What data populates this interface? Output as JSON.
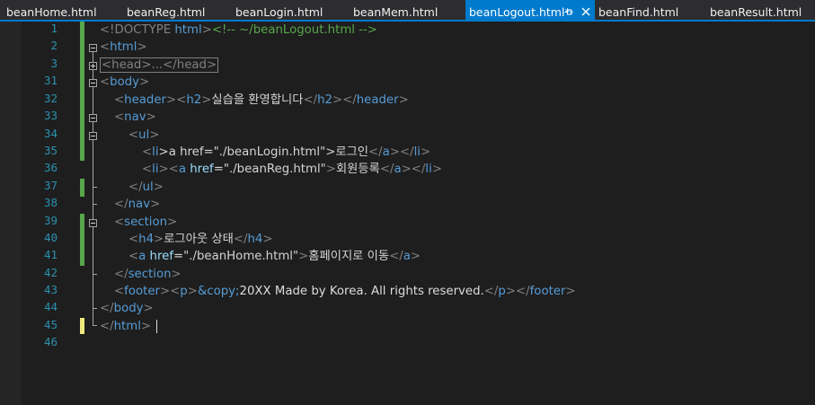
{
  "tabs": [
    {
      "label": "beanHome.html",
      "active": false
    },
    {
      "label": "beanReg.html",
      "active": false
    },
    {
      "label": "beanLogin.html",
      "active": false
    },
    {
      "label": "beanMem.html",
      "active": false
    },
    {
      "label": "beanLogout.html*",
      "active": true
    },
    {
      "label": "beanFind.html",
      "active": false
    },
    {
      "label": "beanResult.html",
      "active": false
    }
  ],
  "active_tab_icons": {
    "pin": "pin-icon",
    "close": "close-icon"
  },
  "colors": {
    "accent": "#007acc",
    "saved_change": "#57a64a",
    "unsaved_change": "#efe77d"
  },
  "line_numbers": [
    "1",
    "2",
    "3",
    "31",
    "32",
    "33",
    "34",
    "35",
    "36",
    "37",
    "38",
    "39",
    "40",
    "41",
    "42",
    "43",
    "44",
    "45",
    "46"
  ],
  "code": {
    "l1": [
      "<!DOCTYPE ",
      "html",
      ">",
      "<!-- ~/beanLogout.html -->"
    ],
    "l2": [
      "<",
      "html",
      ">"
    ],
    "l3": "<head>...</head>",
    "l31": [
      "<",
      "body",
      ">"
    ],
    "l32": [
      "<",
      "header",
      "><",
      "h2",
      ">",
      "실습을 환영합니다",
      "</",
      "h2",
      "></",
      "header",
      ">"
    ],
    "l33": [
      "<",
      "nav",
      ">"
    ],
    "l34": [
      "<",
      "ul",
      ">"
    ],
    "l35": [
      "<",
      "li",
      ">a href=\"./beanLogin.html\">로그인",
      "</",
      "a",
      "></",
      "li",
      ">"
    ],
    "l36": [
      "<",
      "li",
      "><",
      "a",
      " href",
      "=\"",
      "./beanReg.html",
      "\"",
      ">",
      "회원등록",
      "</",
      "a",
      "></",
      "li",
      ">"
    ],
    "l37": [
      "</",
      "ul",
      ">"
    ],
    "l38": [
      "</",
      "nav",
      ">"
    ],
    "l39": [
      "<",
      "section",
      ">"
    ],
    "l40": [
      "<",
      "h4",
      ">",
      "로그아웃 상태",
      "</",
      "h4",
      ">"
    ],
    "l41": [
      "<",
      "a",
      " href",
      "=\"",
      "./beanHome.html",
      "\"",
      ">",
      "홈페이지로 이동",
      "</",
      "a",
      ">"
    ],
    "l42": [
      "</",
      "section",
      ">"
    ],
    "l43": [
      "<",
      "footer",
      "><",
      "p",
      ">",
      "&copy;",
      "20XX Made by Korea. All rights reserved.",
      "</",
      "p",
      "></",
      "footer",
      ">"
    ],
    "l44": [
      "</",
      "body",
      ">"
    ],
    "l45": [
      "</",
      "html",
      ">"
    ]
  }
}
